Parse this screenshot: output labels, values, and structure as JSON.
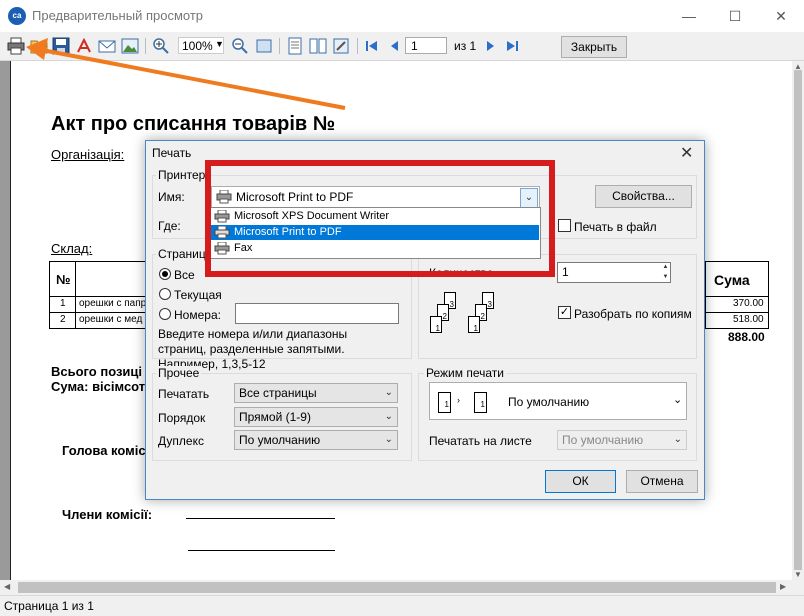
{
  "window": {
    "title": "Предварительный просмотр",
    "logo": "ca",
    "minimize": "—",
    "maximize": "☐",
    "close": "✕"
  },
  "toolbar": {
    "zoom": "100%",
    "page": "1",
    "of_pages": "из 1",
    "close_label": "Закрыть",
    "icons": [
      "print-icon",
      "open-icon",
      "save-icon",
      "pdf-icon",
      "email-icon",
      "image-icon",
      "zoom-in-icon",
      "zoom-out-icon",
      "fit-page-icon",
      "page-setup-icon",
      "two-pages-icon",
      "settings-icon",
      "first-page-icon",
      "prev-page-icon",
      "next-page-icon",
      "last-page-icon"
    ]
  },
  "document": {
    "title": "Акт про списання товарів №",
    "org_label": "Організація:",
    "stock_label": "Склад:",
    "col_no": "№",
    "col_sum": "Сума",
    "rows": [
      {
        "no": "1",
        "name": "орешки с папр",
        "sum": "370.00"
      },
      {
        "no": "2",
        "name": "орешки с мед",
        "sum": "518.00"
      }
    ],
    "total": "888.00",
    "total_line1": "Всього позиці",
    "total_line2": "Сума: вісімсот",
    "head_label": "Голова комісі",
    "members_label": "Члени комісії:"
  },
  "dialog": {
    "title": "Печать",
    "printer_group": "Принтер",
    "name_label": "Имя:",
    "printer_selected": "Microsoft Print to PDF",
    "where_label": "Где:",
    "properties_button": "Свойства...",
    "print_to_file": "Печать в файл",
    "printer_options": [
      "Microsoft XPS Document Writer",
      "Microsoft Print to PDF",
      "Fax"
    ],
    "printer_highlighted_index": 1,
    "pages_group": "Страницы",
    "radio_all": "Все",
    "radio_current": "Текущая",
    "radio_numbers": "Номера:",
    "pages_hint": "Введите номера и/или диапазоны страниц, разделенные запятыми. Например, 1,3,5-12",
    "copies_label": "Количество",
    "copies_value": "1",
    "collate_label": "Разобрать по копиям",
    "other_group": "Прочее",
    "print_label": "Печатать",
    "print_value": "Все страницы",
    "order_label": "Порядок",
    "order_value": "Прямой (1-9)",
    "duplex_label": "Дуплекс",
    "duplex_value": "По умолчанию",
    "print_mode_group": "Режим печати",
    "print_mode_value": "По умолчанию",
    "print_on_sheet_label": "Печатать на листе",
    "print_on_sheet_value": "По умолчанию",
    "ok_button": "ОК",
    "cancel_button": "Отмена"
  },
  "status": {
    "text": "Страница 1 из 1"
  },
  "colors": {
    "highlight": "#d51b1b",
    "arrow": "#f07a1e",
    "selection": "#0078d7"
  }
}
